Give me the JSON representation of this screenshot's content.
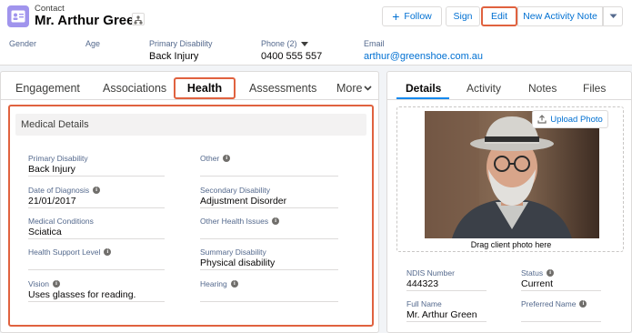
{
  "header": {
    "object_type": "Contact",
    "name": "Mr. Arthur Green",
    "buttons": {
      "follow": "Follow",
      "sign": "Sign",
      "edit": "Edit",
      "new_activity_note": "New Activity Note"
    },
    "fields": [
      {
        "label": "Gender",
        "value": ""
      },
      {
        "label": "Age",
        "value": ""
      },
      {
        "label": "Primary Disability",
        "value": "Back Injury"
      },
      {
        "label": "Phone (2)",
        "value": "0400 555 557"
      },
      {
        "label": "Email",
        "value": "arthur@greenshoe.com.au"
      }
    ]
  },
  "left_tabs": {
    "engagement": "Engagement",
    "associations": "Associations",
    "health": "Health",
    "assessments": "Assessments",
    "more": "More"
  },
  "medical": {
    "title": "Medical Details",
    "fields": {
      "primary_disability": {
        "label": "Primary Disability",
        "value": "Back Injury"
      },
      "other": {
        "label": "Other",
        "value": ""
      },
      "date_of_diagnosis": {
        "label": "Date of Diagnosis",
        "value": "21/01/2017"
      },
      "secondary_disability": {
        "label": "Secondary Disability",
        "value": "Adjustment Disorder"
      },
      "medical_conditions": {
        "label": "Medical Conditions",
        "value": "Sciatica"
      },
      "other_health_issues": {
        "label": "Other Health Issues",
        "value": ""
      },
      "health_support_level": {
        "label": "Health Support Level",
        "value": ""
      },
      "summary_disability": {
        "label": "Summary Disability",
        "value": "Physical disability"
      },
      "vision": {
        "label": "Vision",
        "value": "Uses glasses for reading."
      },
      "hearing": {
        "label": "Hearing",
        "value": ""
      }
    }
  },
  "right_tabs": {
    "details": "Details",
    "activity": "Activity",
    "notes": "Notes",
    "files": "Files"
  },
  "photo": {
    "upload_label": "Upload Photo",
    "drag_hint": "Drag client photo here"
  },
  "details": {
    "ndis_number": {
      "label": "NDIS Number",
      "value": "444323"
    },
    "status": {
      "label": "Status",
      "value": "Current"
    },
    "full_name": {
      "label": "Full Name",
      "value": "Mr. Arthur Green"
    },
    "preferred_name": {
      "label": "Preferred Name",
      "value": ""
    }
  },
  "colors": {
    "highlight": "#e0623f",
    "brand": "#0070d2",
    "contact_icon": "#a094ed"
  }
}
